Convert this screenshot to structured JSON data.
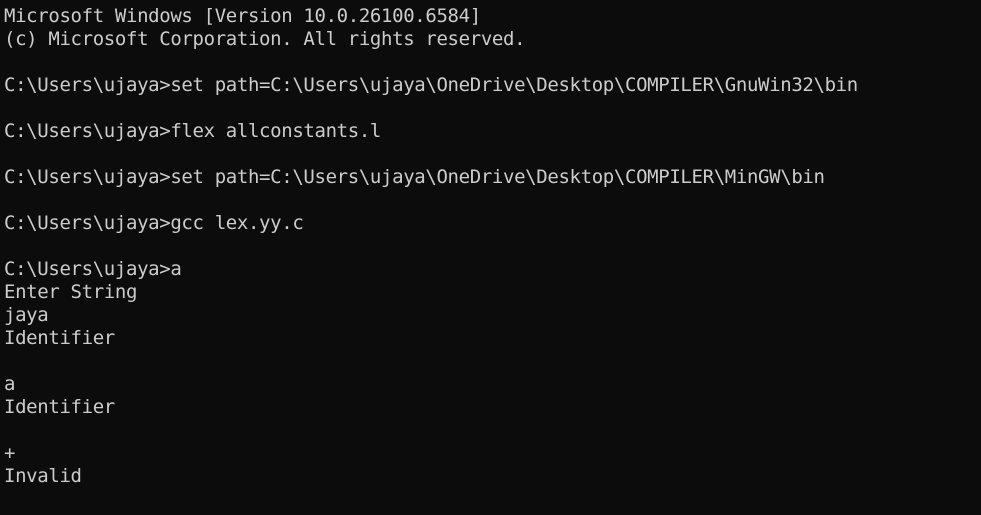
{
  "terminal": {
    "lines": [
      "Microsoft Windows [Version 10.0.26100.6584]",
      "(c) Microsoft Corporation. All rights reserved.",
      "",
      "C:\\Users\\ujaya>set path=C:\\Users\\ujaya\\OneDrive\\Desktop\\COMPILER\\GnuWin32\\bin",
      "",
      "C:\\Users\\ujaya>flex allconstants.l",
      "",
      "C:\\Users\\ujaya>set path=C:\\Users\\ujaya\\OneDrive\\Desktop\\COMPILER\\MinGW\\bin",
      "",
      "C:\\Users\\ujaya>gcc lex.yy.c",
      "",
      "C:\\Users\\ujaya>a",
      "Enter String",
      "jaya",
      "Identifier",
      "",
      "a",
      "Identifier",
      "",
      "+",
      "Invalid"
    ]
  }
}
